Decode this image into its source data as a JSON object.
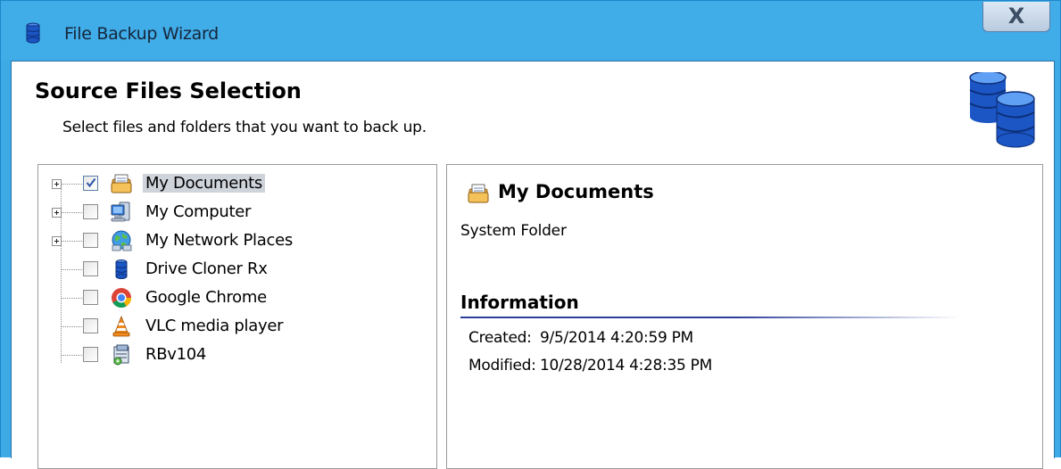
{
  "window": {
    "title": "File Backup Wizard",
    "close_glyph": "X"
  },
  "header": {
    "title": "Source Files Selection",
    "subtitle": "Select files and folders that you want to back up."
  },
  "tree": {
    "items": [
      {
        "label": "My Documents",
        "checked": true,
        "expandable": true,
        "selected": true,
        "icon": "documents-folder-icon"
      },
      {
        "label": "My Computer",
        "checked": false,
        "expandable": true,
        "selected": false,
        "icon": "computer-icon"
      },
      {
        "label": "My Network Places",
        "checked": false,
        "expandable": true,
        "selected": false,
        "icon": "network-places-icon"
      },
      {
        "label": "Drive Cloner Rx",
        "checked": false,
        "expandable": false,
        "selected": false,
        "icon": "database-icon"
      },
      {
        "label": "Google Chrome",
        "checked": false,
        "expandable": false,
        "selected": false,
        "icon": "chrome-icon"
      },
      {
        "label": "VLC media player",
        "checked": false,
        "expandable": false,
        "selected": false,
        "icon": "vlc-cone-icon"
      },
      {
        "label": "RBv104",
        "checked": false,
        "expandable": false,
        "selected": false,
        "icon": "rb-installer-icon"
      }
    ]
  },
  "details": {
    "title": "My Documents",
    "type": "System Folder",
    "info_heading": "Information",
    "created_label": "Created:",
    "created_value": "9/5/2014 4:20:59 PM",
    "modified_label": "Modified:",
    "modified_value": "10/28/2014 4:28:35 PM"
  },
  "colors": {
    "titlebar": "#40ace8",
    "selection": "#cfd3da",
    "info_rule": "#2b3f9a",
    "database_blue": "#1b56c4"
  }
}
